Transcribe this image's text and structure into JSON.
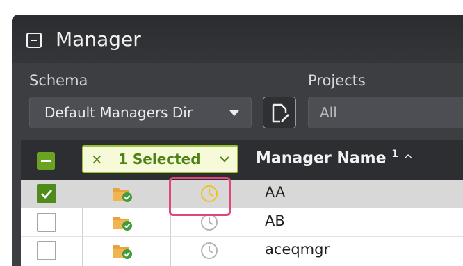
{
  "window": {
    "title": "Manager"
  },
  "filters": {
    "schema_label": "Schema",
    "schema_value": "Default Managers Dir",
    "projects_label": "Projects",
    "projects_value": "All"
  },
  "table": {
    "selection_chip": {
      "close": "×",
      "text": "1 Selected"
    },
    "column_header": {
      "label": "Manager Name",
      "sort_index": "1",
      "sort_arrow": "^"
    },
    "rows": [
      {
        "checked": true,
        "name": "AA",
        "clock_color": "#f2c21b"
      },
      {
        "checked": false,
        "name": "AB",
        "clock_color": "#b4b4b4"
      },
      {
        "checked": false,
        "name": "aceqmgr",
        "clock_color": "#b4b4b4"
      }
    ]
  },
  "colors": {
    "accent_green": "#69a321",
    "highlight": "#e0457b",
    "folder_orange": "#e8a33a",
    "badge_green": "#3f9d3a"
  }
}
